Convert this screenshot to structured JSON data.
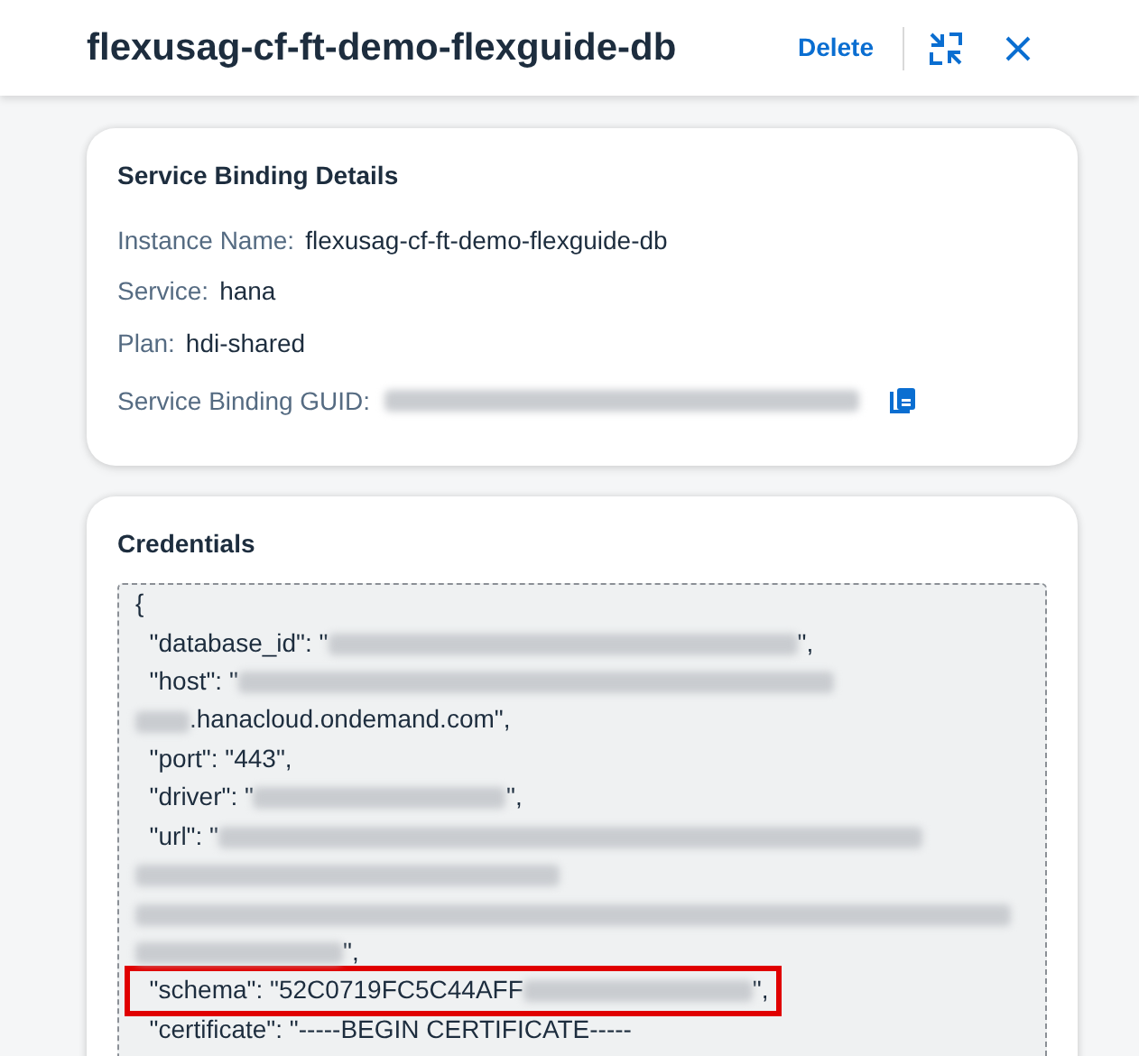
{
  "header": {
    "title": "flexusag-cf-ft-demo-flexguide-db",
    "actions": [
      {
        "kind": "link",
        "label": "Delete"
      },
      {
        "kind": "exit-fullscreen"
      },
      {
        "kind": "close"
      }
    ]
  },
  "details": {
    "title": "Service Binding Details",
    "fields": [
      {
        "label": "Instance Name:",
        "value": "flexusag-cf-ft-demo-flexguide-db"
      },
      {
        "label": "Service:",
        "value": "hana"
      },
      {
        "label": "Plan:",
        "value": "hdi-shared"
      },
      {
        "label": "Service Binding GUID:",
        "kind": "redacted",
        "copy": true
      }
    ]
  },
  "credentials": {
    "title": "Credentials",
    "lines": [
      {
        "highlighted": false,
        "parts": [
          {
            "kind": "text",
            "text": "{"
          }
        ]
      },
      {
        "highlighted": false,
        "parts": [
          {
            "kind": "text",
            "text": "  \"database_id\": \""
          },
          {
            "kind": "redacted"
          },
          {
            "kind": "text",
            "text": "\","
          }
        ]
      },
      {
        "highlighted": false,
        "parts": [
          {
            "kind": "text",
            "text": "  \"host\": \""
          },
          {
            "kind": "redacted"
          }
        ]
      },
      {
        "highlighted": false,
        "parts": [
          {
            "kind": "redacted"
          },
          {
            "kind": "text",
            "text": ".hanacloud.ondemand.com\","
          }
        ]
      },
      {
        "highlighted": false,
        "parts": [
          {
            "kind": "text",
            "text": "  \"port\": \"443\","
          }
        ]
      },
      {
        "highlighted": false,
        "parts": [
          {
            "kind": "text",
            "text": "  \"driver\": \""
          },
          {
            "kind": "redacted"
          },
          {
            "kind": "text",
            "text": "\","
          }
        ]
      },
      {
        "highlighted": false,
        "parts": [
          {
            "kind": "text",
            "text": "  \"url\": \""
          },
          {
            "kind": "redacted"
          }
        ]
      },
      {
        "highlighted": false,
        "parts": [
          {
            "kind": "redacted"
          }
        ]
      },
      {
        "highlighted": false,
        "parts": [
          {
            "kind": "redacted"
          }
        ]
      },
      {
        "highlighted": false,
        "parts": [
          {
            "kind": "redacted"
          },
          {
            "kind": "text",
            "text": "\","
          }
        ]
      },
      {
        "highlighted": true,
        "parts": [
          {
            "kind": "text",
            "text": "  \"schema\": \"52C0719FC5C44AFF"
          },
          {
            "kind": "redacted"
          },
          {
            "kind": "text",
            "text": "\","
          }
        ]
      },
      {
        "highlighted": false,
        "parts": [
          {
            "kind": "text",
            "text": "  \"certificate\": \"-----BEGIN CERTIFICATE-----"
          }
        ]
      }
    ]
  }
}
